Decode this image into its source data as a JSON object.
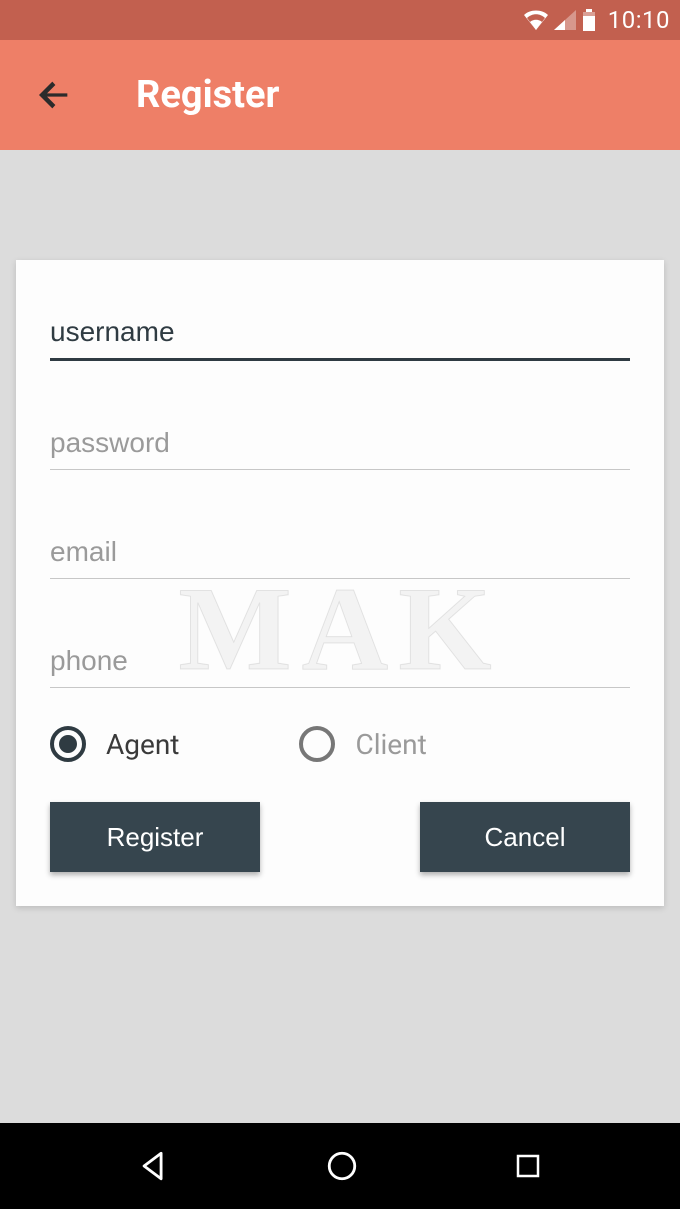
{
  "status": {
    "time": "10:10"
  },
  "appbar": {
    "title": "Register"
  },
  "fields": {
    "username": {
      "placeholder": "username"
    },
    "password": {
      "placeholder": "password"
    },
    "email": {
      "placeholder": "email"
    },
    "phone": {
      "placeholder": "phone"
    }
  },
  "roles": {
    "agent": {
      "label": "Agent",
      "selected": true
    },
    "client": {
      "label": "Client",
      "selected": false
    }
  },
  "buttons": {
    "register": "Register",
    "cancel": "Cancel"
  },
  "watermark": "MAK"
}
